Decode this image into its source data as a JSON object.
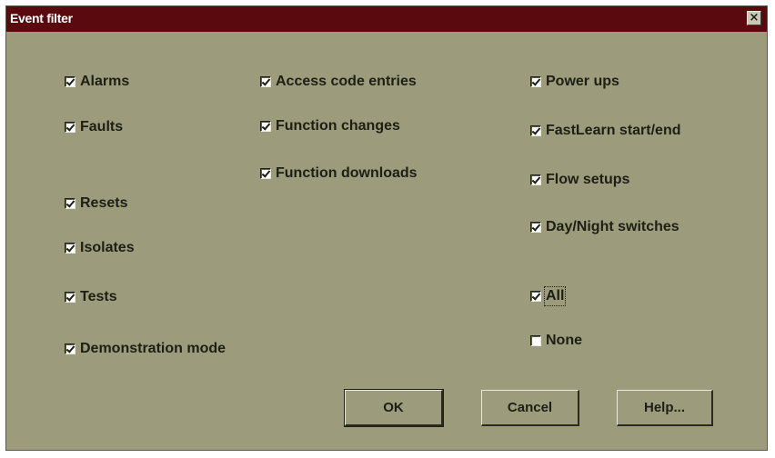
{
  "window": {
    "title": "Event filter",
    "close_glyph": "×"
  },
  "checkboxes": {
    "alarms": {
      "label": "Alarms",
      "checked": true
    },
    "faults": {
      "label": "Faults",
      "checked": true
    },
    "resets": {
      "label": "Resets",
      "checked": true
    },
    "isolates": {
      "label": "Isolates",
      "checked": true
    },
    "tests": {
      "label": "Tests",
      "checked": true
    },
    "demonstration_mode": {
      "label": "Demonstration mode",
      "checked": true
    },
    "access_code_entries": {
      "label": "Access code entries",
      "checked": true
    },
    "function_changes": {
      "label": "Function changes",
      "checked": true
    },
    "function_downloads": {
      "label": "Function downloads",
      "checked": true
    },
    "power_ups": {
      "label": "Power ups",
      "checked": true
    },
    "fastlearn": {
      "label": "FastLearn start/end",
      "checked": true
    },
    "flow_setups": {
      "label": "Flow setups",
      "checked": true
    },
    "day_night": {
      "label": "Day/Night switches",
      "checked": true
    },
    "all": {
      "label": "All",
      "checked": true
    },
    "none": {
      "label": "None",
      "checked": false
    }
  },
  "buttons": {
    "ok": "OK",
    "cancel": "Cancel",
    "help": "Help..."
  },
  "colors": {
    "dialog_background": "#9c9c7c",
    "title_bar": "#5a0a0e"
  }
}
